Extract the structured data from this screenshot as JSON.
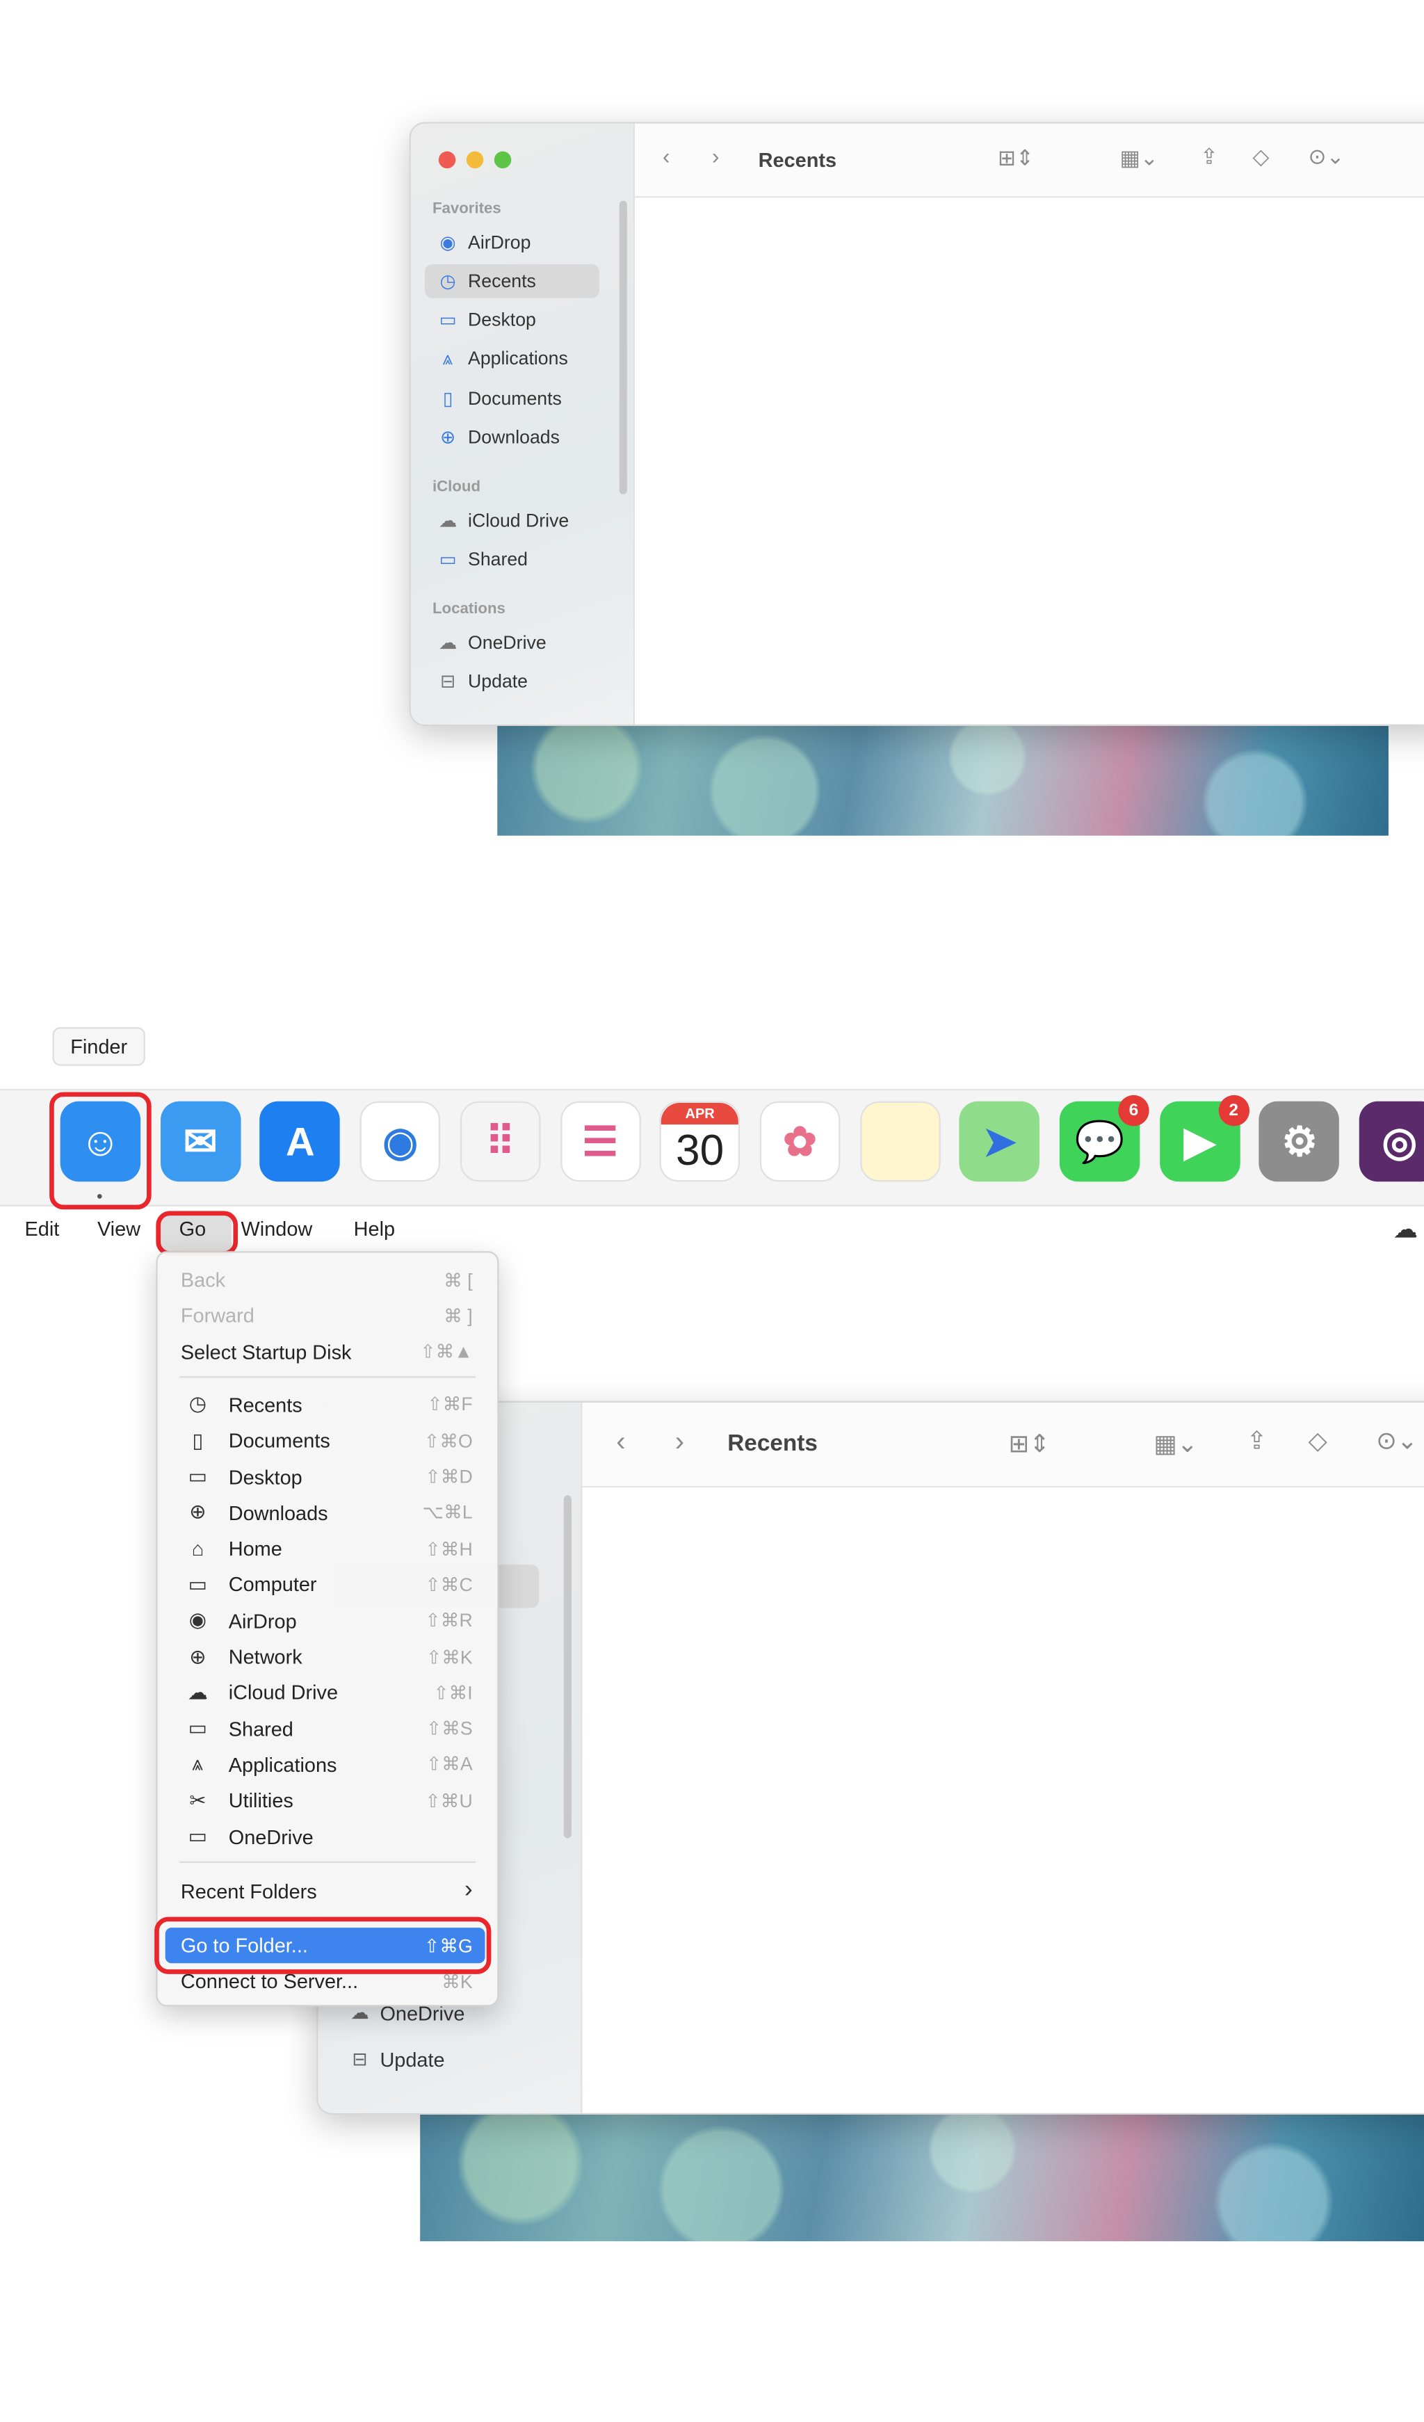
{
  "top_window": {
    "title": "Recents",
    "sidebar": [
      {
        "type": "section",
        "label": "Favorites"
      },
      {
        "label": "AirDrop",
        "icon": "airdrop-icon",
        "glyph": "◉"
      },
      {
        "label": "Recents",
        "icon": "clock-icon",
        "glyph": "◷",
        "selected": true
      },
      {
        "label": "Desktop",
        "icon": "desktop-icon",
        "glyph": "▭"
      },
      {
        "label": "Applications",
        "icon": "applications-icon",
        "glyph": "⩓"
      },
      {
        "label": "Documents",
        "icon": "document-icon",
        "glyph": "▯"
      },
      {
        "label": "Downloads",
        "icon": "download-icon",
        "glyph": "⊕"
      },
      {
        "type": "section",
        "label": "iCloud"
      },
      {
        "label": "iCloud Drive",
        "icon": "cloud-icon",
        "glyph": "☁"
      },
      {
        "label": "Shared",
        "icon": "shared-folder-icon",
        "glyph": "▭"
      },
      {
        "type": "section",
        "label": "Locations"
      },
      {
        "label": "OneDrive",
        "icon": "cloud-icon",
        "glyph": "☁"
      },
      {
        "label": "Update",
        "icon": "drive-icon",
        "glyph": "⊟"
      }
    ]
  },
  "tooltip": "Finder",
  "dock": [
    {
      "name": "finder",
      "color": "#2f8ff0",
      "glyph": "☺"
    },
    {
      "name": "mail",
      "color": "#3a9bf0",
      "glyph": "✉"
    },
    {
      "name": "app-store",
      "color": "#1e7ff0",
      "glyph": "A"
    },
    {
      "name": "chrome",
      "color": "#ffffff",
      "glyph": "◉"
    },
    {
      "name": "launchpad",
      "color": "#f4f4f4",
      "glyph": "⠿"
    },
    {
      "name": "reminders",
      "color": "#ffffff",
      "glyph": "☰"
    },
    {
      "name": "calendar",
      "color": "#ffffff",
      "month": "APR",
      "day": "30"
    },
    {
      "name": "photos",
      "color": "#ffffff",
      "glyph": "✿"
    },
    {
      "name": "notes",
      "color": "#fff6cf",
      "glyph": ""
    },
    {
      "name": "maps",
      "color": "#8fdc8a",
      "glyph": "➤"
    },
    {
      "name": "messages",
      "color": "#3fd35a",
      "glyph": "💬",
      "badge": "6"
    },
    {
      "name": "facetime",
      "color": "#3fd35a",
      "glyph": "▶",
      "badge": "2"
    },
    {
      "name": "system-settings",
      "color": "#8d8d8d",
      "glyph": "⚙"
    },
    {
      "name": "siri",
      "color": "#5a2a6a",
      "glyph": "◎"
    }
  ],
  "menubar": [
    "Edit",
    "View",
    "Go",
    "Window",
    "Help"
  ],
  "go_menu": [
    {
      "label": "Back",
      "shortcut": "⌘ [",
      "disabled": true
    },
    {
      "label": "Forward",
      "shortcut": "⌘ ]",
      "disabled": true
    },
    {
      "label": "Select Startup Disk",
      "shortcut": "⇧⌘▲"
    },
    {
      "type": "sep"
    },
    {
      "label": "Recents",
      "shortcut": "⇧⌘F",
      "icon": "clock-icon",
      "glyph": "◷"
    },
    {
      "label": "Documents",
      "shortcut": "⇧⌘O",
      "icon": "document-icon",
      "glyph": "▯"
    },
    {
      "label": "Desktop",
      "shortcut": "⇧⌘D",
      "icon": "desktop-icon",
      "glyph": "▭"
    },
    {
      "label": "Downloads",
      "shortcut": "⌥⌘L",
      "icon": "download-icon",
      "glyph": "⊕"
    },
    {
      "label": "Home",
      "shortcut": "⇧⌘H",
      "icon": "home-icon",
      "glyph": "⌂"
    },
    {
      "label": "Computer",
      "shortcut": "⇧⌘C",
      "icon": "computer-icon",
      "glyph": "▭"
    },
    {
      "label": "AirDrop",
      "shortcut": "⇧⌘R",
      "icon": "airdrop-icon",
      "glyph": "◉"
    },
    {
      "label": "Network",
      "shortcut": "⇧⌘K",
      "icon": "globe-icon",
      "glyph": "⊕"
    },
    {
      "label": "iCloud Drive",
      "shortcut": "⇧⌘I",
      "icon": "cloud-icon",
      "glyph": "☁"
    },
    {
      "label": "Shared",
      "shortcut": "⇧⌘S",
      "icon": "shared-folder-icon",
      "glyph": "▭"
    },
    {
      "label": "Applications",
      "shortcut": "⇧⌘A",
      "icon": "applications-icon",
      "glyph": "⩓"
    },
    {
      "label": "Utilities",
      "shortcut": "⇧⌘U",
      "icon": "utilities-icon",
      "glyph": "✂"
    },
    {
      "label": "OneDrive",
      "shortcut": "",
      "icon": "folder-icon",
      "glyph": "▭"
    },
    {
      "type": "sep"
    },
    {
      "label": "Recent Folders",
      "shortcut": "›"
    },
    {
      "label": "Go to Folder...",
      "shortcut": "⇧⌘G",
      "highlighted": true
    },
    {
      "label": "Connect to Server...",
      "shortcut": "⌘K"
    }
  ],
  "bottom_window": {
    "title": "Recents",
    "sidebar_visible": [
      {
        "label": "OneDrive",
        "icon": "cloud-icon",
        "glyph": "☁"
      },
      {
        "label": "Update",
        "icon": "drive-icon",
        "glyph": "⊟"
      }
    ]
  },
  "colors": {
    "highlight": "#3d84ee",
    "annotation": "#e8262b",
    "sidebar_icon": "#3a7be0"
  }
}
